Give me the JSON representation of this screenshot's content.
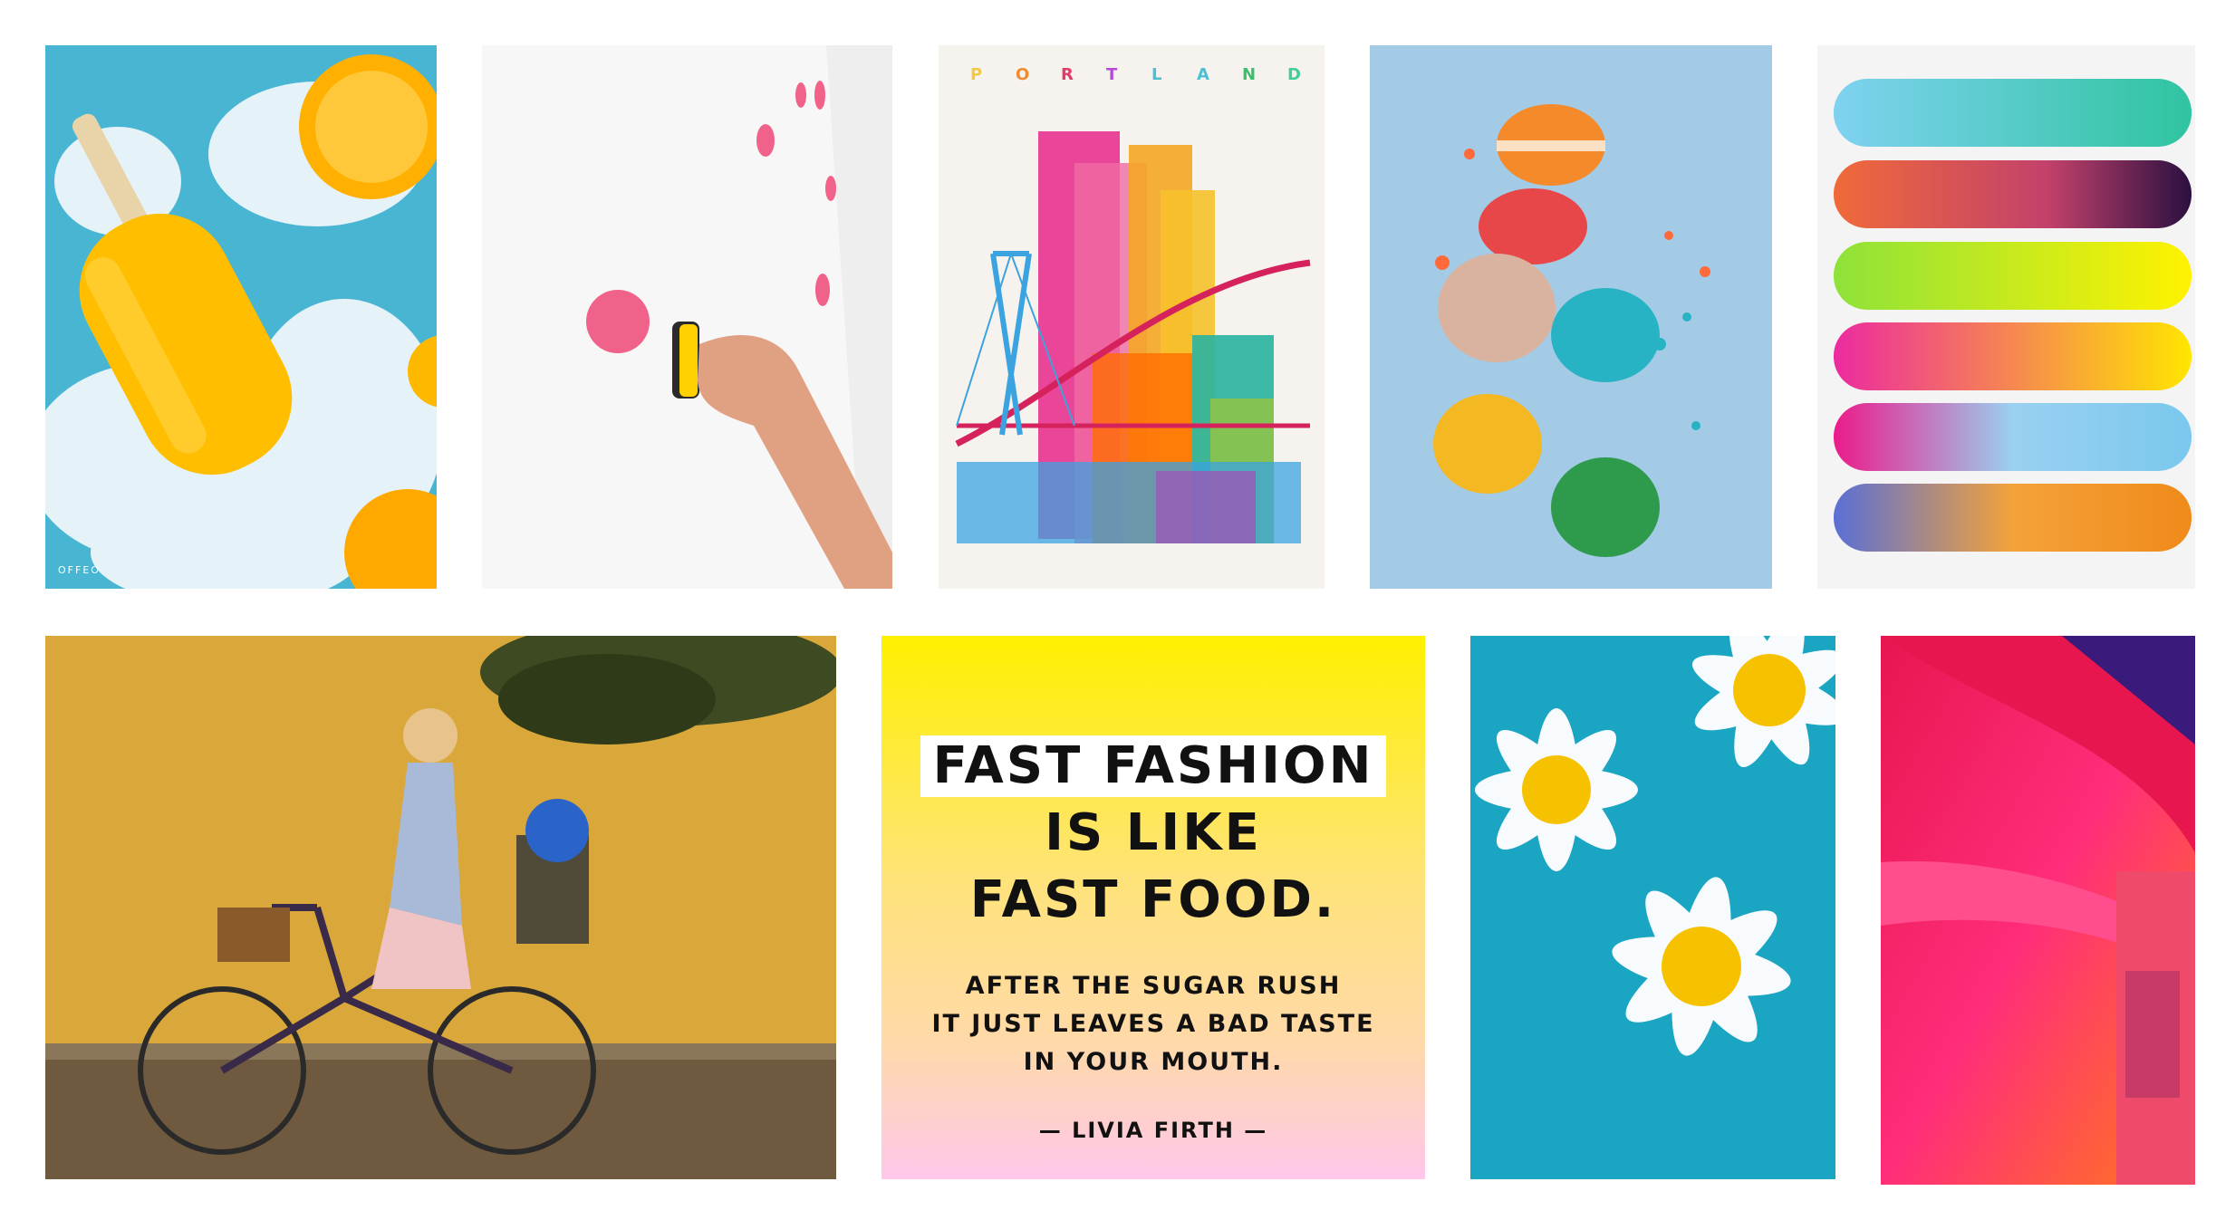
{
  "tiles": {
    "popsicle": {
      "brand": "OFFEO"
    },
    "portland": {
      "letters": [
        "P",
        "O",
        "R",
        "T",
        "L",
        "A",
        "N",
        "D"
      ]
    },
    "quote": {
      "headline": [
        "FAST FASHION",
        "IS LIKE",
        "FAST FOOD."
      ],
      "sub": [
        "AFTER THE SUGAR RUSH",
        "IT JUST LEAVES A BAD TASTE",
        "IN YOUR MOUTH."
      ],
      "author": "— LIVIA FIRTH —"
    }
  },
  "colors": {
    "popsicle_bg": "#4fb9d6",
    "portland_bg": "#f6f3ef",
    "macaron_bg": "#9fc9e6",
    "gradient_bg": "#f4f4f4",
    "bike_wall": "#d9a73a",
    "daisy_bg": "#1aa6c3"
  }
}
